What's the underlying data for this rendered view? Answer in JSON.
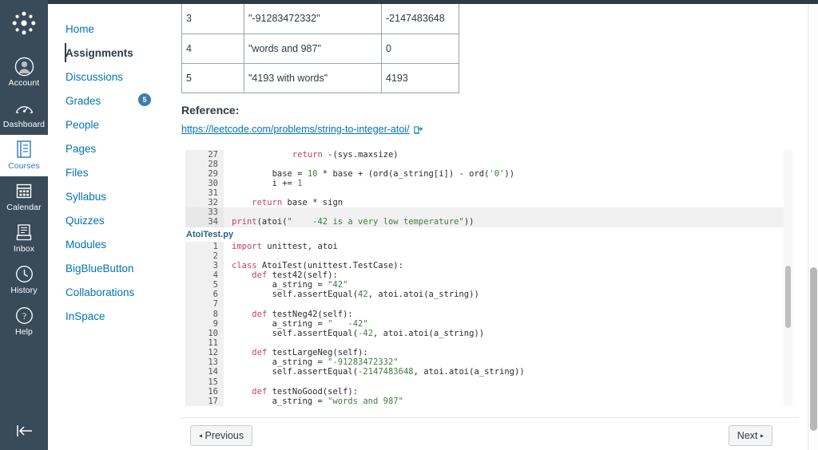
{
  "global_nav": {
    "logo_name": "canvas-logo",
    "items": [
      {
        "label": "Account",
        "icon": "account-icon",
        "active": false
      },
      {
        "label": "Dashboard",
        "icon": "dashboard-icon",
        "active": false
      },
      {
        "label": "Courses",
        "icon": "courses-icon",
        "active": true
      },
      {
        "label": "Calendar",
        "icon": "calendar-icon",
        "active": false
      },
      {
        "label": "Inbox",
        "icon": "inbox-icon",
        "active": false
      },
      {
        "label": "History",
        "icon": "history-icon",
        "active": false
      },
      {
        "label": "Help",
        "icon": "help-icon",
        "active": false
      }
    ],
    "collapse_icon": "collapse-left-icon"
  },
  "course_nav": {
    "items": [
      {
        "label": "Home",
        "active": false,
        "badge": null
      },
      {
        "label": "Assignments",
        "active": true,
        "badge": null
      },
      {
        "label": "Discussions",
        "active": false,
        "badge": null
      },
      {
        "label": "Grades",
        "active": false,
        "badge": "5"
      },
      {
        "label": "People",
        "active": false,
        "badge": null
      },
      {
        "label": "Pages",
        "active": false,
        "badge": null
      },
      {
        "label": "Files",
        "active": false,
        "badge": null
      },
      {
        "label": "Syllabus",
        "active": false,
        "badge": null
      },
      {
        "label": "Quizzes",
        "active": false,
        "badge": null
      },
      {
        "label": "Modules",
        "active": false,
        "badge": null
      },
      {
        "label": "BigBlueButton",
        "active": false,
        "badge": null
      },
      {
        "label": "Collaborations",
        "active": false,
        "badge": null
      },
      {
        "label": "InSpace",
        "active": false,
        "badge": null
      }
    ]
  },
  "examples_table": {
    "rows": [
      {
        "index": "3",
        "input": "\"-91283472332\"",
        "output": "-2147483648"
      },
      {
        "index": "4",
        "input": "\"words and 987\"",
        "output": "0"
      },
      {
        "index": "5",
        "input": "\"4193 with words\"",
        "output": "4193"
      }
    ]
  },
  "reference": {
    "heading": "Reference:",
    "link_text": "https://leetcode.com/problems/string-to-integer-atoi/",
    "external_icon": "external-link-icon"
  },
  "code_block_1": {
    "lines": [
      {
        "n": "27",
        "alt": false,
        "tokens": [
          {
            "t": "            ",
            "c": ""
          },
          {
            "t": "return",
            "c": "kw"
          },
          {
            "t": " -(sys.maxsize)",
            "c": ""
          }
        ]
      },
      {
        "n": "28",
        "alt": false,
        "tokens": []
      },
      {
        "n": "29",
        "alt": false,
        "tokens": [
          {
            "t": "        base = ",
            "c": ""
          },
          {
            "t": "10",
            "c": "num"
          },
          {
            "t": " * base + (ord(a_string[i]) - ord(",
            "c": ""
          },
          {
            "t": "'0'",
            "c": "str"
          },
          {
            "t": "))",
            "c": ""
          }
        ]
      },
      {
        "n": "30",
        "alt": false,
        "tokens": [
          {
            "t": "        i += ",
            "c": ""
          },
          {
            "t": "1",
            "c": "num"
          }
        ]
      },
      {
        "n": "31",
        "alt": false,
        "tokens": []
      },
      {
        "n": "32",
        "alt": false,
        "tokens": [
          {
            "t": "    ",
            "c": ""
          },
          {
            "t": "return",
            "c": "kw"
          },
          {
            "t": " base * sign",
            "c": ""
          }
        ]
      },
      {
        "n": "33",
        "alt": true,
        "tokens": []
      },
      {
        "n": "34",
        "alt": true,
        "tokens": [
          {
            "t": "print",
            "c": "kw"
          },
          {
            "t": "(atoi(",
            "c": ""
          },
          {
            "t": "\"    -42 is a very low temperature\"",
            "c": "str"
          },
          {
            "t": "))",
            "c": ""
          }
        ]
      }
    ]
  },
  "file_label": "AtoiTest.py",
  "code_block_2": {
    "lines": [
      {
        "n": "1",
        "alt": false,
        "tokens": [
          {
            "t": "import",
            "c": "kw"
          },
          {
            "t": " unittest, atoi",
            "c": ""
          }
        ]
      },
      {
        "n": "2",
        "alt": false,
        "tokens": []
      },
      {
        "n": "3",
        "alt": false,
        "tokens": [
          {
            "t": "class",
            "c": "kw"
          },
          {
            "t": " AtoiTest(unittest.TestCase):",
            "c": ""
          }
        ]
      },
      {
        "n": "4",
        "alt": false,
        "tokens": [
          {
            "t": "    ",
            "c": ""
          },
          {
            "t": "def",
            "c": "kw"
          },
          {
            "t": " test42(self):",
            "c": ""
          }
        ]
      },
      {
        "n": "5",
        "alt": false,
        "tokens": [
          {
            "t": "        a_string = ",
            "c": ""
          },
          {
            "t": "\"42\"",
            "c": "str"
          }
        ]
      },
      {
        "n": "6",
        "alt": false,
        "tokens": [
          {
            "t": "        self.assertEqual(",
            "c": ""
          },
          {
            "t": "42",
            "c": "num"
          },
          {
            "t": ", atoi.atoi(a_string))",
            "c": ""
          }
        ]
      },
      {
        "n": "7",
        "alt": false,
        "tokens": []
      },
      {
        "n": "8",
        "alt": false,
        "tokens": [
          {
            "t": "    ",
            "c": ""
          },
          {
            "t": "def",
            "c": "kw"
          },
          {
            "t": " testNeg42(self):",
            "c": ""
          }
        ]
      },
      {
        "n": "9",
        "alt": false,
        "tokens": [
          {
            "t": "        a_string = ",
            "c": ""
          },
          {
            "t": "\"   -42\"",
            "c": "str"
          }
        ]
      },
      {
        "n": "10",
        "alt": false,
        "tokens": [
          {
            "t": "        self.assertEqual(",
            "c": ""
          },
          {
            "t": "-42",
            "c": "num"
          },
          {
            "t": ", atoi.atoi(a_string))",
            "c": ""
          }
        ]
      },
      {
        "n": "11",
        "alt": false,
        "tokens": []
      },
      {
        "n": "12",
        "alt": false,
        "tokens": [
          {
            "t": "    ",
            "c": ""
          },
          {
            "t": "def",
            "c": "kw"
          },
          {
            "t": " testLargeNeg(self):",
            "c": ""
          }
        ]
      },
      {
        "n": "13",
        "alt": false,
        "tokens": [
          {
            "t": "        a_string = ",
            "c": ""
          },
          {
            "t": "\"-91283472332\"",
            "c": "str"
          }
        ]
      },
      {
        "n": "14",
        "alt": false,
        "tokens": [
          {
            "t": "        self.assertEqual(",
            "c": ""
          },
          {
            "t": "-2147483648",
            "c": "num"
          },
          {
            "t": ", atoi.atoi(a_string))",
            "c": ""
          }
        ]
      },
      {
        "n": "15",
        "alt": false,
        "tokens": []
      },
      {
        "n": "16",
        "alt": false,
        "tokens": [
          {
            "t": "    ",
            "c": ""
          },
          {
            "t": "def",
            "c": "kw"
          },
          {
            "t": " testNoGood(self):",
            "c": ""
          }
        ]
      },
      {
        "n": "17",
        "alt": false,
        "tokens": [
          {
            "t": "        a_string = ",
            "c": ""
          },
          {
            "t": "\"words and 987\"",
            "c": "str"
          }
        ]
      }
    ]
  },
  "footer": {
    "previous_label": "Previous",
    "next_label": "Next",
    "prev_arrow": "◂",
    "next_arrow": "▸"
  },
  "colors": {
    "global_nav_bg": "#394B58",
    "link_blue": "#0374B5",
    "badge_blue": "#3B7CB0",
    "text_dark": "#2D3B45",
    "keyword": "#C1416B",
    "literal": "#3F7D3F"
  }
}
